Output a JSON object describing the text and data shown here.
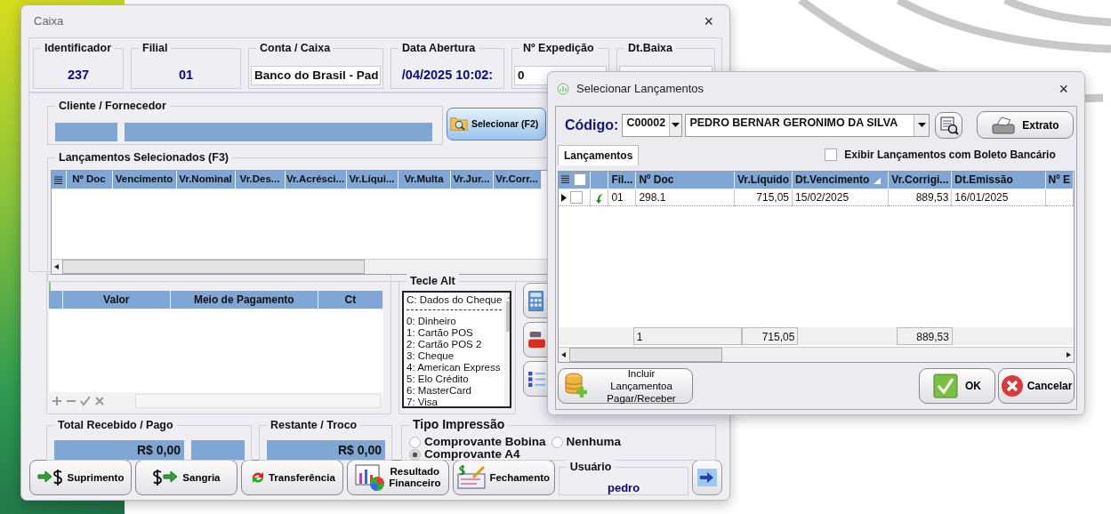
{
  "main_window": {
    "title": "Caixa",
    "close": "×"
  },
  "header_fields": [
    {
      "label": "Identificador",
      "value": "237",
      "kind": "display"
    },
    {
      "label": "Filial",
      "value": "01",
      "kind": "display"
    },
    {
      "label": "Conta / Caixa",
      "value": "Banco do Brasil - Pad",
      "kind": "combo"
    },
    {
      "label": "Data Abertura",
      "value": "/04/2025 10:02:",
      "kind": "display"
    },
    {
      "label": "Nº Expedição",
      "value": "0",
      "kind": "spin"
    },
    {
      "label": "Dt.Baixa",
      "kind": "date"
    }
  ],
  "client": {
    "label": "Cliente / Fornecedor",
    "select_button": "Selecionar (F2)"
  },
  "selected_entries": {
    "title": "Lançamentos Selecionados (F3)",
    "columns": [
      "Nº Doc",
      "Vencimento",
      "Vr.Nominal",
      "Vr.Des...",
      "Vr.Acrésci...",
      "Vr.Líqui...",
      "Vr.Multa",
      "Vr.Jur...",
      "Vr.Corr..."
    ]
  },
  "payments": {
    "columns": [
      "Valor",
      "Meio de Pagamento",
      "Ct"
    ]
  },
  "shortcuts": {
    "title": "Tecle Alt",
    "items": [
      {
        "kind": "item",
        "text": "C: Dados do Cheque"
      },
      {
        "kind": "separator"
      },
      {
        "kind": "item",
        "text": "0: Dinheiro"
      },
      {
        "kind": "item",
        "text": "1: Cartão POS"
      },
      {
        "kind": "item",
        "text": "2: Cartão POS 2"
      },
      {
        "kind": "item",
        "text": "3: Cheque"
      },
      {
        "kind": "item",
        "text": "4: American Express"
      },
      {
        "kind": "item",
        "text": "5: Elo Crédito"
      },
      {
        "kind": "item",
        "text": "6: MasterCard"
      },
      {
        "kind": "item",
        "text": "7: Visa"
      }
    ]
  },
  "totals": [
    {
      "label": "Total Recebido / Pago",
      "value": "R$ 0,00",
      "kind": "received"
    },
    {
      "label": "Restante / Troco",
      "value": "R$ 0,00",
      "kind": "change"
    }
  ],
  "print_type": {
    "title": "Tipo Impressão",
    "options": [
      {
        "label": "Comprovante Bobina",
        "selected": false
      },
      {
        "label": "Nenhuma",
        "selected": false
      },
      {
        "label": "Comprovante A4",
        "selected": true
      }
    ]
  },
  "bottom_buttons": [
    {
      "label": "Suprimento",
      "kind": "supply"
    },
    {
      "label": "Sangria",
      "kind": "withdraw"
    },
    {
      "label": "Transferência",
      "kind": "transfer"
    },
    {
      "label": "Resultado Financeiro",
      "kind": "report"
    },
    {
      "label": "Fechamento",
      "kind": "closing"
    }
  ],
  "user": {
    "label": "Usuário",
    "value": "pedro"
  },
  "dialog": {
    "title": "Selecionar Lançamentos",
    "close": "×",
    "code_label": "Código:",
    "code": "C00002",
    "name": "PEDRO BERNAR GERONIMO DA SILVA",
    "statement_button": "Extrato",
    "tabs": [
      {
        "label": "Lançamentos",
        "selected": true
      }
    ],
    "boleto_checkbox": {
      "label": "Exibir Lançamentos com Boleto Bancário",
      "checked": false
    },
    "grid": {
      "columns": [
        {
          "label": "Fil...",
          "sorted": false
        },
        {
          "label": "Nº Doc",
          "sorted": false
        },
        {
          "label": "Vr.Líquido",
          "sorted": false
        },
        {
          "label": "Dt.Vencimento",
          "sorted": true
        },
        {
          "label": "Vr.Corrigi...",
          "sorted": false
        },
        {
          "label": "Dt.Emissão",
          "sorted": false
        },
        {
          "label": "Nº E",
          "sorted": false
        }
      ],
      "select_all_checked": false,
      "rows": [
        {
          "current": true,
          "checked": false,
          "cells": [
            "01",
            "298.1",
            "715,05",
            "15/02/2025",
            "889,53",
            "16/01/2025",
            ""
          ]
        }
      ],
      "footer": {
        "count": "1",
        "net_total": "715,05",
        "corrected_total": "889,53"
      }
    },
    "include_button": "Incluir Lançamentoa Pagar/Receber",
    "ok_button": "OK",
    "cancel_button": "Cancelar"
  }
}
